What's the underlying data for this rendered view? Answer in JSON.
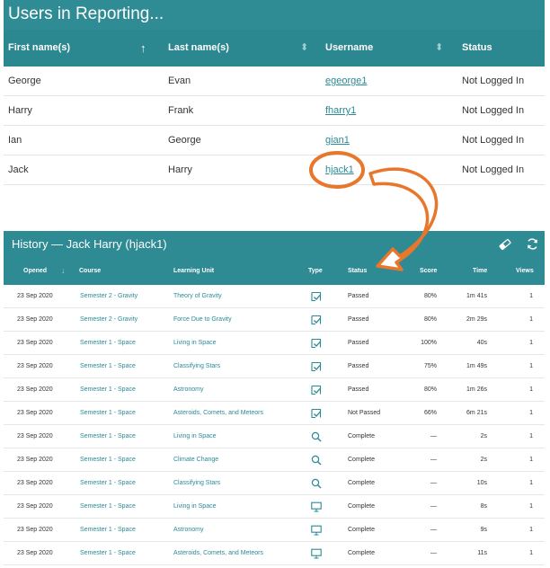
{
  "users": {
    "title": "Users in Reporting...",
    "columns": [
      "First name(s)",
      "Last name(s)",
      "Username",
      "Status"
    ],
    "sort_icons": {
      "first": "arrow-up-icon",
      "other": "sort-both-icon"
    },
    "rows": [
      {
        "first": "George",
        "last": "Evan",
        "username": "egeorge1",
        "status": "Not Logged In"
      },
      {
        "first": "Harry",
        "last": "Frank",
        "username": "fharry1",
        "status": "Not Logged In"
      },
      {
        "first": "Ian",
        "last": "George",
        "username": "gian1",
        "status": "Not Logged In"
      },
      {
        "first": "Jack",
        "last": "Harry",
        "username": "hjack1",
        "status": "Not Logged In"
      }
    ]
  },
  "history": {
    "title": "History — Jack Harry (hjack1)",
    "tools": [
      "eraser-icon",
      "refresh-icon"
    ],
    "columns": [
      "Opened",
      "Course",
      "Learning Unit",
      "Type",
      "Status",
      "Score",
      "Time",
      "Views"
    ],
    "rows": [
      {
        "opened": "23 Sep 2020",
        "course": "Semester 2 - Gravity",
        "unit": "Theory of Gravity",
        "type": "quiz",
        "status": "Passed",
        "score": "80%",
        "time": "1m 41s",
        "views": "1"
      },
      {
        "opened": "23 Sep 2020",
        "course": "Semester 2 - Gravity",
        "unit": "Force Due to Gravity",
        "type": "quiz",
        "status": "Passed",
        "score": "80%",
        "time": "2m 29s",
        "views": "1"
      },
      {
        "opened": "23 Sep 2020",
        "course": "Semester 1 - Space",
        "unit": "Living in Space",
        "type": "quiz",
        "status": "Passed",
        "score": "100%",
        "time": "40s",
        "views": "1"
      },
      {
        "opened": "23 Sep 2020",
        "course": "Semester 1 - Space",
        "unit": "Classifying Stars",
        "type": "quiz",
        "status": "Passed",
        "score": "75%",
        "time": "1m 49s",
        "views": "1"
      },
      {
        "opened": "23 Sep 2020",
        "course": "Semester 1 - Space",
        "unit": "Astronomy",
        "type": "quiz",
        "status": "Passed",
        "score": "80%",
        "time": "1m 26s",
        "views": "1"
      },
      {
        "opened": "23 Sep 2020",
        "course": "Semester 1 - Space",
        "unit": "Asteroids, Comets, and Meteors",
        "type": "quiz",
        "status": "Not Passed",
        "score": "66%",
        "time": "6m 21s",
        "views": "1"
      },
      {
        "opened": "23 Sep 2020",
        "course": "Semester 1 - Space",
        "unit": "Living in Space",
        "type": "search",
        "status": "Complete",
        "score": "—",
        "time": "2s",
        "views": "1"
      },
      {
        "opened": "23 Sep 2020",
        "course": "Semester 1 - Space",
        "unit": "Climate Change",
        "type": "search",
        "status": "Complete",
        "score": "—",
        "time": "2s",
        "views": "1"
      },
      {
        "opened": "23 Sep 2020",
        "course": "Semester 1 - Space",
        "unit": "Classifying Stars",
        "type": "search",
        "status": "Complete",
        "score": "—",
        "time": "10s",
        "views": "1"
      },
      {
        "opened": "23 Sep 2020",
        "course": "Semester 1 - Space",
        "unit": "Living in Space",
        "type": "presentation",
        "status": "Complete",
        "score": "—",
        "time": "8s",
        "views": "1"
      },
      {
        "opened": "23 Sep 2020",
        "course": "Semester 1 - Space",
        "unit": "Astronomy",
        "type": "presentation",
        "status": "Complete",
        "score": "—",
        "time": "9s",
        "views": "1"
      },
      {
        "opened": "23 Sep 2020",
        "course": "Semester 1 - Space",
        "unit": "Asteroids, Comets, and Meteors",
        "type": "presentation",
        "status": "Complete",
        "score": "—",
        "time": "11s",
        "views": "1"
      }
    ]
  },
  "annotation": {
    "color": "#e8762b",
    "target_username": "hjack1"
  },
  "colors": {
    "header": "#2f8c95",
    "link": "#2a8a96"
  }
}
